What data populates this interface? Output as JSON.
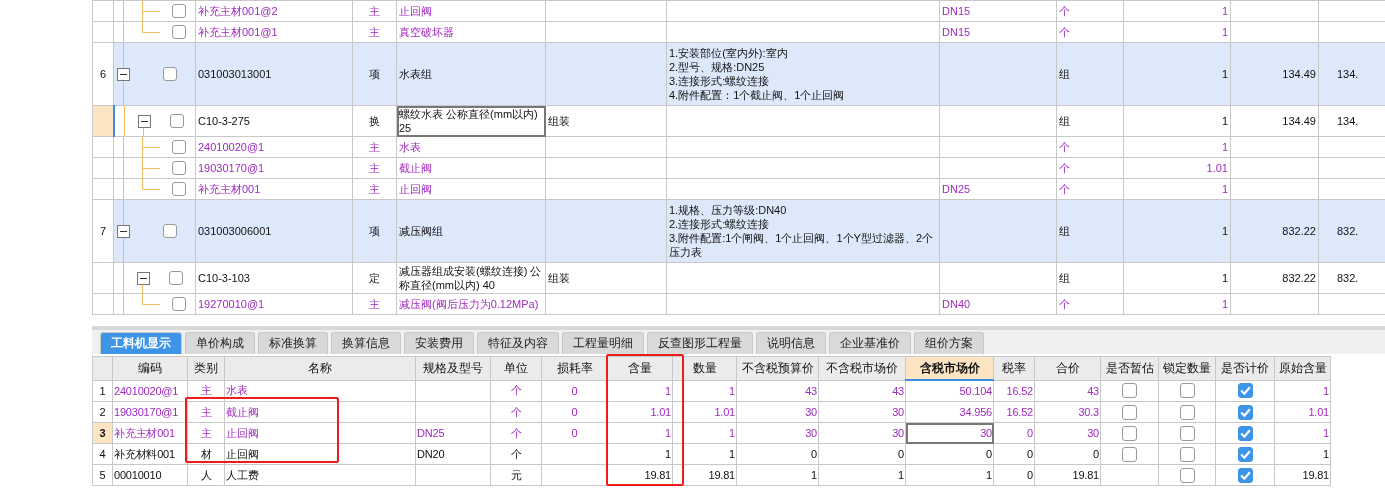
{
  "top_table": {
    "continued_materials": [
      {
        "checked": false,
        "code": "补充主材001@2",
        "type": "主",
        "name": "止回阀",
        "spec": "DN15",
        "unit": "个",
        "qty": "1"
      },
      {
        "checked": false,
        "code": "补充主材001@1",
        "type": "主",
        "name": "真空破坏器",
        "spec": "DN15",
        "unit": "个",
        "qty": "1"
      }
    ],
    "items": [
      {
        "no": "6",
        "expanded": true,
        "checked": false,
        "code": "031003013001",
        "type": "项",
        "name": "水表组",
        "features": [
          "1.安装部位(室内外):室内",
          "2.型号、规格:DN25",
          "3.连接形式:螺纹连接",
          "4.附件配置：1个截止阀、1个止回阀"
        ],
        "unit": "组",
        "qty": "1",
        "price": "134.49",
        "total": "134.",
        "children": [
          {
            "selected": true,
            "expanded": true,
            "checked": false,
            "code": "C10-3-275",
            "type": "换",
            "name": "螺纹水表 公称直径(mm以内) 25",
            "work": "组装",
            "unit": "组",
            "qty": "1",
            "price": "134.49",
            "total": "134.",
            "children": [
              {
                "checked": false,
                "code": "24010020@1",
                "type": "主",
                "name": "水表",
                "unit": "个",
                "qty": "1"
              },
              {
                "checked": false,
                "code": "19030170@1",
                "type": "主",
                "name": "截止阀",
                "unit": "个",
                "qty": "1.01"
              },
              {
                "checked": false,
                "code": "补充主材001",
                "type": "主",
                "name": "止回阀",
                "spec": "DN25",
                "unit": "个",
                "qty": "1"
              }
            ]
          }
        ]
      },
      {
        "no": "7",
        "expanded": true,
        "checked": false,
        "code": "031003006001",
        "type": "项",
        "name": "减压阀组",
        "features": [
          "1.规格、压力等级:DN40",
          "2.连接形式:螺纹连接",
          "3.附件配置:1个闸阀、1个止回阀、1个Y型过滤器、2个压力表"
        ],
        "unit": "组",
        "qty": "1",
        "price": "832.22",
        "total": "832.",
        "children": [
          {
            "selected": false,
            "expanded": true,
            "checked": false,
            "code": "C10-3-103",
            "type": "定",
            "name": "减压器组成安装(螺纹连接) 公称直径(mm以内) 40",
            "work": "组装",
            "unit": "组",
            "qty": "1",
            "price": "832.22",
            "total": "832.",
            "children": [
              {
                "checked": false,
                "code": "19270010@1",
                "type": "主",
                "name": "减压阀(阀后压力为0.12MPa)",
                "spec": "DN40",
                "unit": "个",
                "qty": "1"
              }
            ]
          }
        ]
      }
    ]
  },
  "tabs": [
    {
      "label": "工料机显示",
      "selected": true
    },
    {
      "label": "单价构成",
      "selected": false
    },
    {
      "label": "标准换算",
      "selected": false
    },
    {
      "label": "换算信息",
      "selected": false
    },
    {
      "label": "安装费用",
      "selected": false
    },
    {
      "label": "特征及内容",
      "selected": false
    },
    {
      "label": "工程量明细",
      "selected": false
    },
    {
      "label": "反查图形工程量",
      "selected": false
    },
    {
      "label": "说明信息",
      "selected": false
    },
    {
      "label": "企业基准价",
      "selected": false
    },
    {
      "label": "组价方案",
      "selected": false
    }
  ],
  "resource_table": {
    "columns": [
      {
        "label": "编码",
        "selected": false
      },
      {
        "label": "类别",
        "selected": false
      },
      {
        "label": "名称",
        "selected": false
      },
      {
        "label": "规格及型号",
        "selected": false
      },
      {
        "label": "单位",
        "selected": false
      },
      {
        "label": "损耗率",
        "selected": false
      },
      {
        "label": "含量",
        "selected": false
      },
      {
        "label": "数量",
        "selected": false
      },
      {
        "label": "不含税预算价",
        "selected": false
      },
      {
        "label": "不含税市场价",
        "selected": false
      },
      {
        "label": "含税市场价",
        "selected": true
      },
      {
        "label": "税率",
        "selected": false
      },
      {
        "label": "合价",
        "selected": false
      },
      {
        "label": "是否暂估",
        "selected": false
      },
      {
        "label": "锁定数量",
        "selected": false
      },
      {
        "label": "是否计价",
        "selected": false
      },
      {
        "label": "原始含量",
        "selected": false
      }
    ],
    "rows": [
      {
        "no": "1",
        "selected": false,
        "kind": "main",
        "code": "24010020@1",
        "category": "主",
        "name": "水表",
        "unit": "个",
        "loss": "0",
        "content": "1",
        "qty": "1",
        "budget_price": "43",
        "market_price": "43",
        "tax_market_price": "50.104",
        "tax_rate": "16.52",
        "total": "43",
        "estimate": false,
        "lock_qty": false,
        "priced": true,
        "original_content": "1"
      },
      {
        "no": "2",
        "selected": false,
        "kind": "main",
        "code": "19030170@1",
        "category": "主",
        "name": "截止阀",
        "unit": "个",
        "loss": "0",
        "content": "1.01",
        "qty": "1.01",
        "budget_price": "30",
        "market_price": "30",
        "tax_market_price": "34.956",
        "tax_rate": "16.52",
        "total": "30.3",
        "estimate": false,
        "lock_qty": false,
        "priced": true,
        "original_content": "1.01"
      },
      {
        "no": "3",
        "selected": true,
        "kind": "main",
        "code": "补充主材001",
        "category": "主",
        "name": "止回阀",
        "spec": "DN25",
        "unit": "个",
        "loss": "0",
        "content": "1",
        "qty": "1",
        "budget_price": "30",
        "market_price": "30",
        "tax_market_price": "30",
        "tax_rate": "0",
        "total": "30",
        "estimate": false,
        "lock_qty": false,
        "priced": true,
        "original_content": "1"
      },
      {
        "no": "4",
        "selected": false,
        "kind": "material",
        "code": "补充材料001",
        "category": "材",
        "name": "止回阀",
        "spec": "DN20",
        "unit": "个",
        "content": "1",
        "qty": "1",
        "budget_price": "0",
        "market_price": "0",
        "tax_market_price": "0",
        "tax_rate": "0",
        "total": "0",
        "estimate": false,
        "lock_qty": false,
        "priced": true,
        "original_content": "1"
      },
      {
        "no": "5",
        "selected": false,
        "kind": "labor",
        "code": "00010010",
        "category": "人",
        "name": "人工费",
        "unit": "元",
        "content": "19.81",
        "qty": "19.81",
        "budget_price": "1",
        "market_price": "1",
        "tax_market_price": "1",
        "tax_rate": "0",
        "total": "19.81",
        "lock_qty": false,
        "priced": true,
        "original_content": "19.81"
      }
    ]
  }
}
